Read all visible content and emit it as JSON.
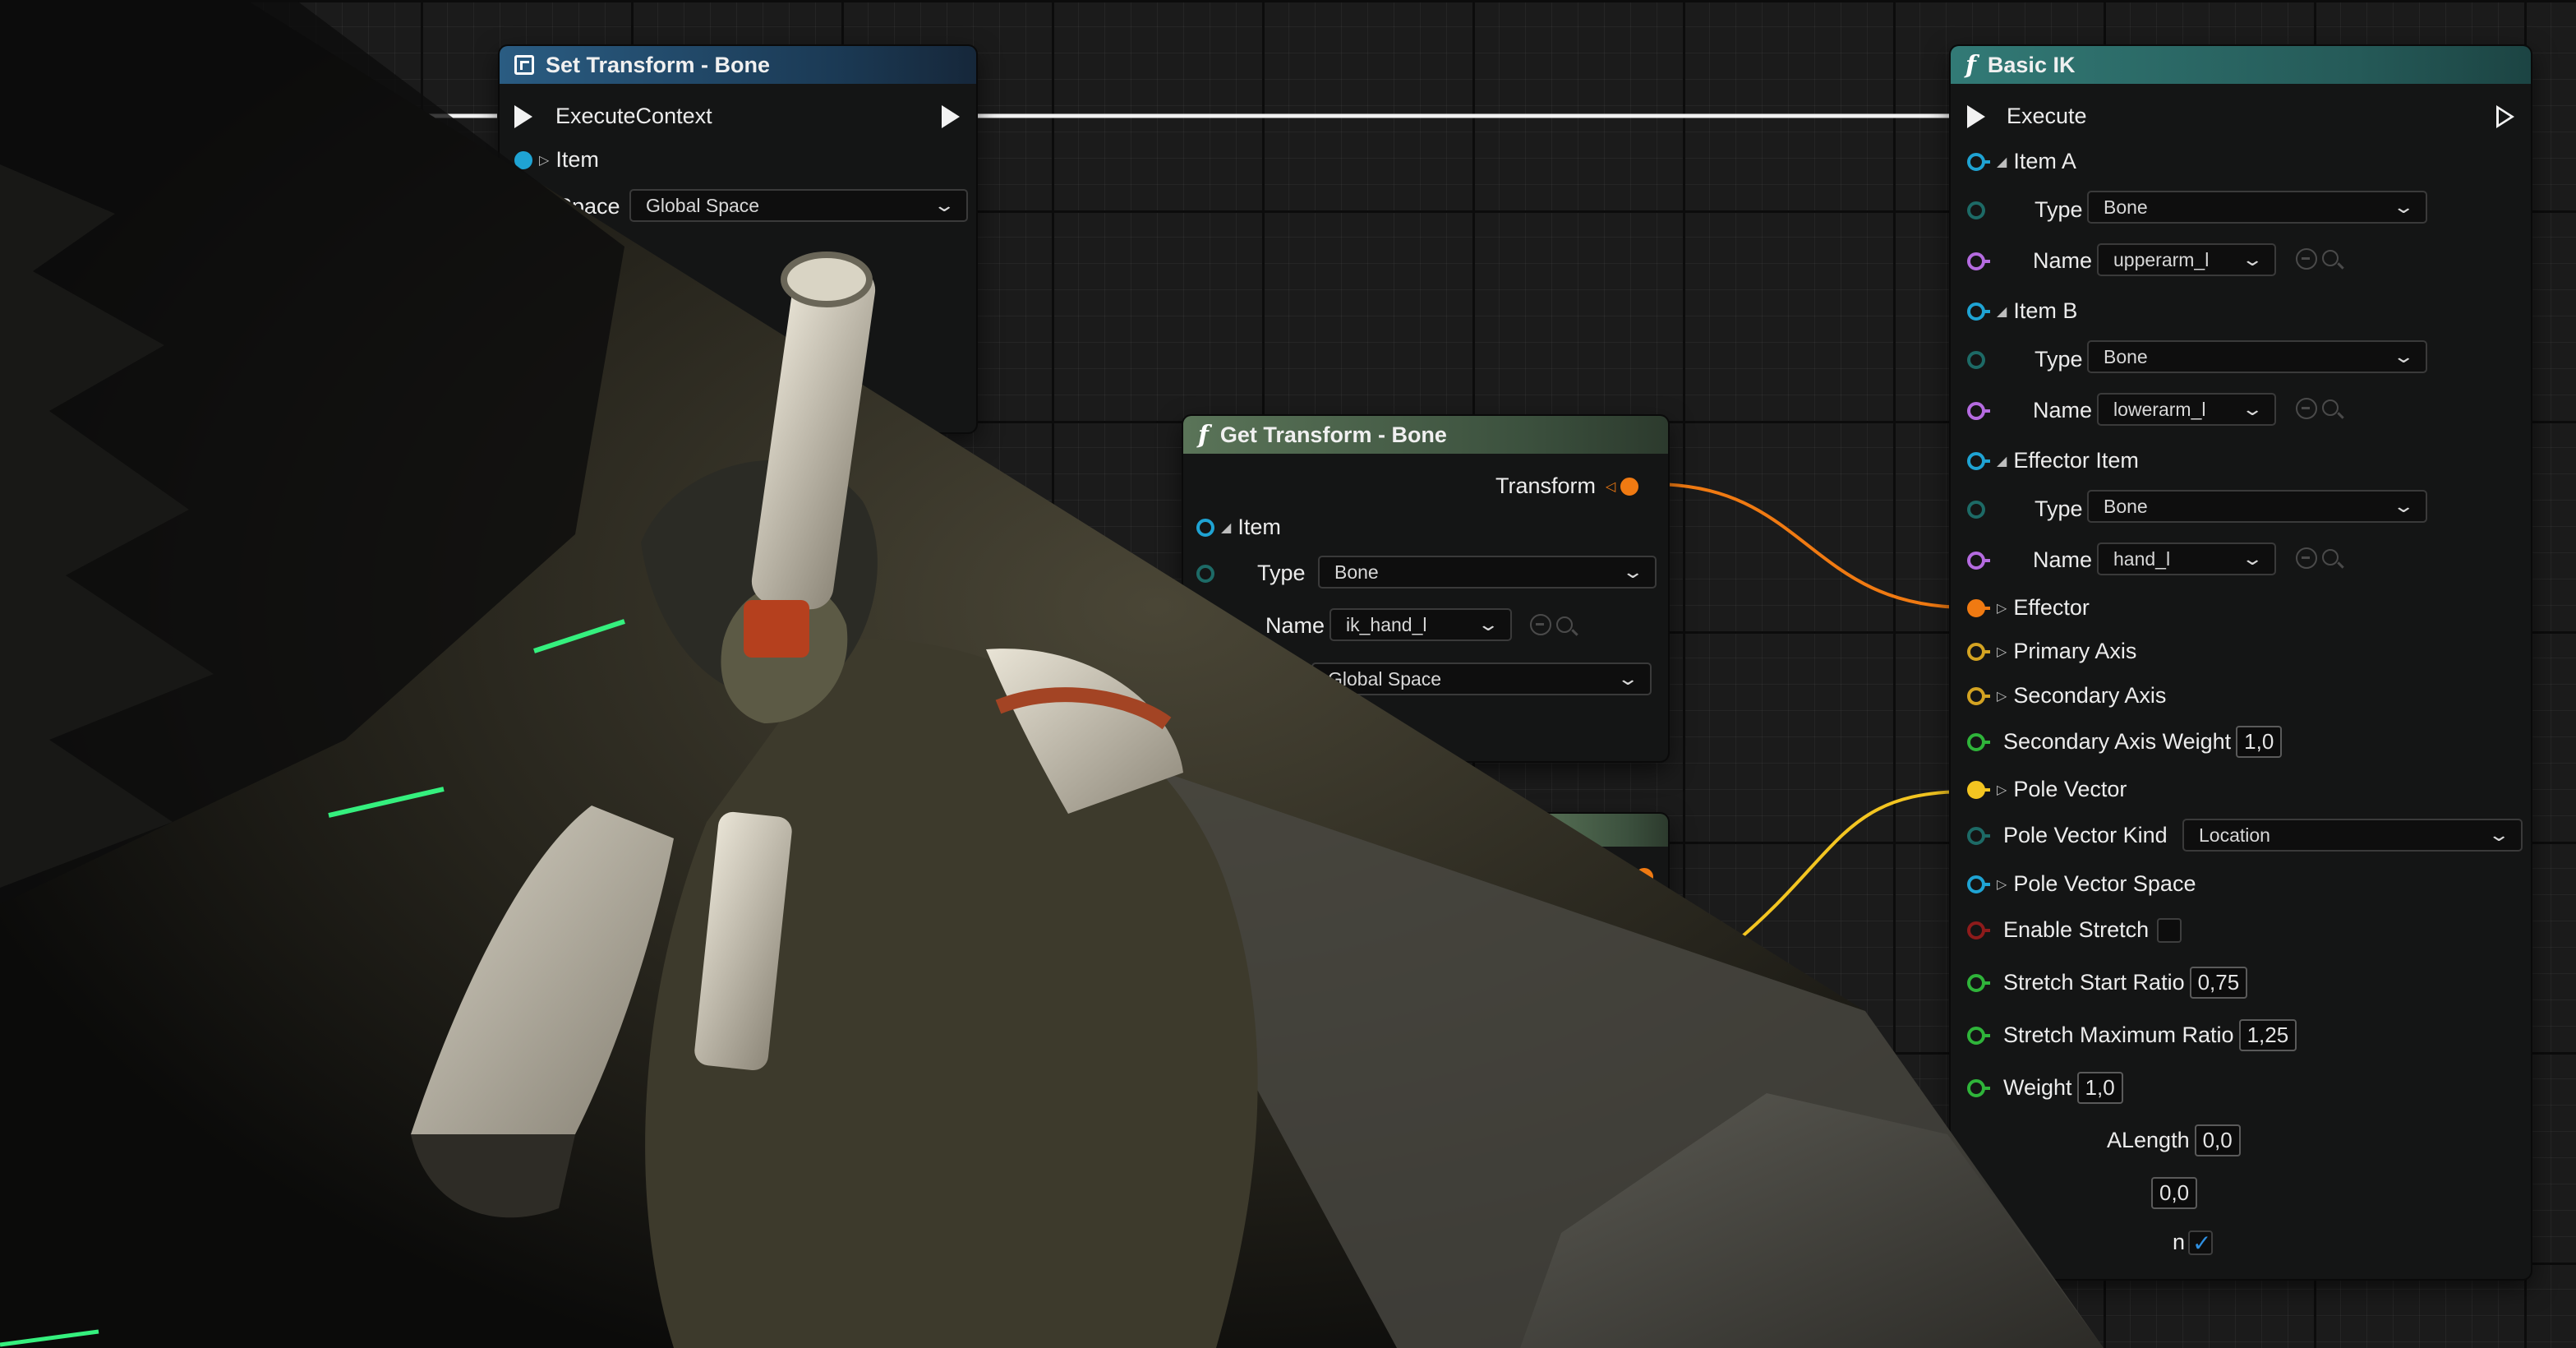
{
  "nodes": {
    "set_transform": {
      "title": "Set Transform - Bone",
      "execute_label": "ExecuteContext",
      "item_label": "Item",
      "space_label": "Space",
      "space_value": "Global Space"
    },
    "get_transform": {
      "title": "Get Transform - Bone",
      "transform_label": "Transform",
      "item_label": "Item",
      "type_label": "Type",
      "type_value": "Bone",
      "name_label": "Name",
      "name_value": "ik_hand_l",
      "space_value": "Global Space"
    },
    "basic_ik": {
      "title": "Basic IK",
      "execute_label": "Execute",
      "item_a_label": "Item A",
      "item_a_type_label": "Type",
      "item_a_type_value": "Bone",
      "item_a_name_label": "Name",
      "item_a_name_value": "upperarm_l",
      "item_b_label": "Item B",
      "item_b_type_label": "Type",
      "item_b_type_value": "Bone",
      "item_b_name_label": "Name",
      "item_b_name_value": "lowerarm_l",
      "effector_item_label": "Effector Item",
      "effector_type_label": "Type",
      "effector_type_value": "Bone",
      "effector_name_label": "Name",
      "effector_name_value": "hand_l",
      "effector_label": "Effector",
      "primary_axis_label": "Primary Axis",
      "secondary_axis_label": "Secondary Axis",
      "secondary_axis_weight_label": "Secondary Axis Weight",
      "secondary_axis_weight_value": "1,0",
      "pole_vector_label": "Pole Vector",
      "pole_vector_kind_label": "Pole Vector Kind",
      "pole_vector_kind_value": "Location",
      "pole_vector_space_label": "Pole Vector Space",
      "enable_stretch_label": "Enable Stretch",
      "stretch_start_ratio_label": "Stretch Start Ratio",
      "stretch_start_ratio_value": "0,75",
      "stretch_maximum_ratio_label": "Stretch Maximum Ratio",
      "stretch_maximum_ratio_value": "1,25",
      "weight_label": "Weight",
      "weight_value": "1,0",
      "bone_a_length_label": "ALength",
      "bone_a_length_value": "0,0",
      "bone_b_length_value": "0,0",
      "propagate_label": "n"
    }
  },
  "colors": {
    "exec_wire": "#f2f2f2",
    "transform_wire": "#f07a12",
    "vector_wire": "#f3c521"
  }
}
